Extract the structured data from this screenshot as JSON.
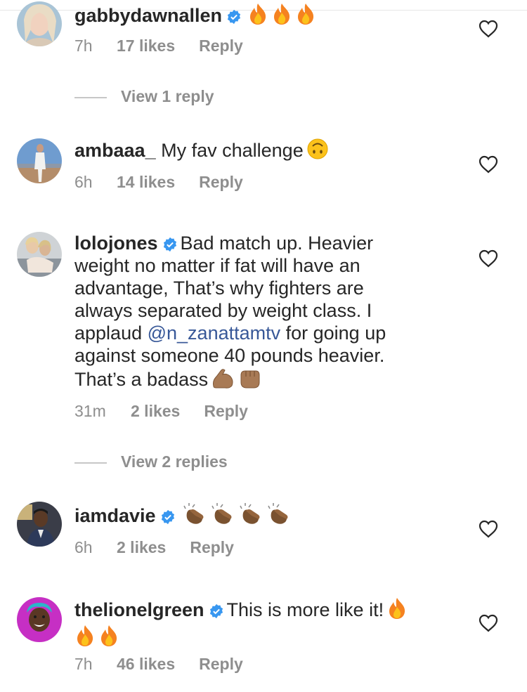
{
  "comments": [
    {
      "username": "gabbydawnallen",
      "verified": true,
      "text": "",
      "emojis": [
        "fire-emoji",
        "fire-emoji",
        "fire-emoji"
      ],
      "time": "7h",
      "likes": "17 likes",
      "reply": "Reply"
    },
    {
      "username": "ambaaa_",
      "verified": false,
      "text": "My fav challenge",
      "emojis": [
        "upside-down-face-emoji"
      ],
      "time": "6h",
      "likes": "14 likes",
      "reply": "Reply"
    },
    {
      "username": "lolojones",
      "verified": true,
      "text_before": "Bad match up. Heavier weight no matter if fat will have an advantage, That’s why fighters are always separated by weight class. I applaud ",
      "mention": "@n_zanattamtv",
      "text_after": " for going up against someone 40 pounds heavier. That’s a badass",
      "emojis": [
        "flexed-biceps-emoji",
        "fist-emoji"
      ],
      "time": "31m",
      "likes": "2 likes",
      "reply": "Reply"
    },
    {
      "username": "iamdavie",
      "verified": true,
      "text": "",
      "emojis": [
        "clapping-hands-emoji",
        "clapping-hands-emoji",
        "clapping-hands-emoji",
        "clapping-hands-emoji"
      ],
      "time": "6h",
      "likes": "2 likes",
      "reply": "Reply"
    },
    {
      "username": "thelionelgreen",
      "verified": true,
      "text": "This is more like it!",
      "emojis": [
        "fire-emoji",
        "fire-emoji",
        "fire-emoji"
      ],
      "time": "7h",
      "likes": "46 likes",
      "reply": "Reply"
    }
  ],
  "view_replies": [
    "View 1 reply",
    "View 2 replies"
  ],
  "colors": {
    "text": "#262626",
    "meta": "#8e8e8e",
    "mention": "#385898",
    "verified": "#3897f0"
  }
}
